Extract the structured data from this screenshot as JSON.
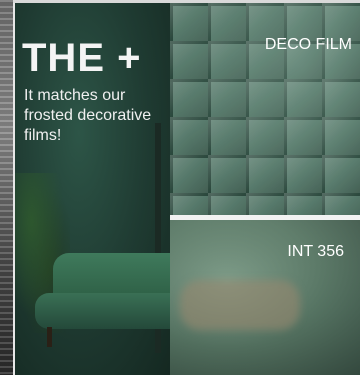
{
  "promo": {
    "headline": "THE +",
    "subtext": "It matches our frosted decorative films!"
  },
  "labels": {
    "deco": "DECO FILM",
    "int": "INT 356"
  },
  "colors": {
    "accent_text": "#ffffff",
    "room_green": "#1f3a30",
    "divider": "#f2f2f2"
  }
}
